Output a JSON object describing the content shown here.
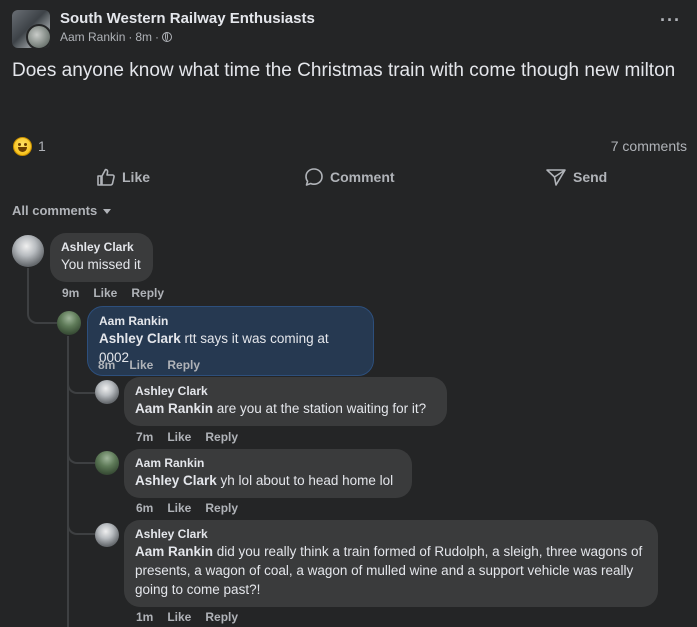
{
  "header": {
    "group_name": "South Western Railway Enthusiasts",
    "author": "Aam Rankin",
    "sep1": "·",
    "time": "8m",
    "sep2": "·",
    "more_label": "···"
  },
  "post": {
    "text": "Does anyone know what time the Christmas train with come though new milton"
  },
  "reactions": {
    "icon": "laughing-emoji-icon",
    "count": "1",
    "comments_count": "7 comments"
  },
  "actions": {
    "like": "Like",
    "comment": "Comment",
    "send": "Send"
  },
  "filter": {
    "label": "All comments"
  },
  "comments": [
    {
      "author": "Ashley Clark",
      "mention": "",
      "text": "You missed it",
      "time": "9m",
      "like": "Like",
      "reply": "Reply"
    },
    {
      "author": "Aam Rankin",
      "mention": "Ashley Clark",
      "text": " rtt says it was coming at 0002",
      "time": "8m",
      "like": "Like",
      "reply": "Reply"
    },
    {
      "author": "Ashley Clark",
      "mention": "Aam Rankin",
      "text": " are you at the station waiting for it?",
      "time": "7m",
      "like": "Like",
      "reply": "Reply"
    },
    {
      "author": "Aam Rankin",
      "mention": "Ashley Clark",
      "text": " yh lol about to head home lol",
      "time": "6m",
      "like": "Like",
      "reply": "Reply"
    },
    {
      "author": "Ashley Clark",
      "mention": "Aam Rankin",
      "text": " did you really think a train formed of Rudolph, a sleigh, three wagons of presents, a wagon of coal, a wagon of mulled wine and a support vehicle was really going to come past?!",
      "time": "1m",
      "like": "Like",
      "reply": "Reply"
    }
  ],
  "colors": {
    "background": "#242526",
    "bubble": "#3a3b3c",
    "highlight_bubble": "#263951",
    "secondary_text": "#b0b3b8"
  }
}
